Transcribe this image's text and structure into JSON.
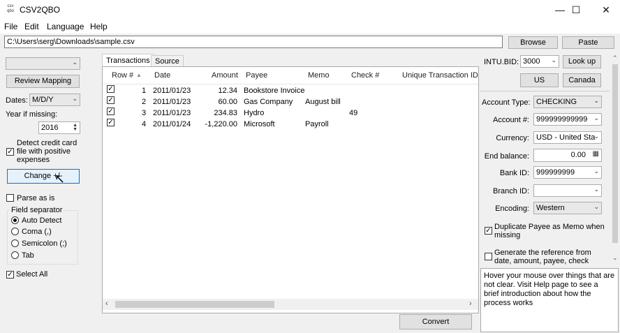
{
  "window": {
    "title": "CSV2QBO",
    "app_icon": "csv\nqbo"
  },
  "menu": [
    "File",
    "Edit",
    "Language",
    "Help"
  ],
  "file_path": "C:\\Users\\serg\\Downloads\\sample.csv",
  "buttons": {
    "browse": "Browse",
    "paste": "Paste",
    "review_mapping": "Review Mapping",
    "change": "Change +/-",
    "convert": "Convert",
    "look_up": "Look up",
    "us": "US",
    "canada": "Canada"
  },
  "left": {
    "dates_label": "Dates:",
    "dates_value": "M/D/Y",
    "year_label": "Year if missing:",
    "year_value": "2016",
    "detect_cc": "Detect credit card file with positive expenses",
    "parse_as_is": "Parse as is",
    "field_separator": "Field separator",
    "radios": [
      "Auto Detect",
      "Coma (,)",
      "Semicolon (;)",
      "Tab"
    ],
    "select_all": "Select All"
  },
  "tabs": [
    "Transactions",
    "Source"
  ],
  "table": {
    "headers": [
      "Row #",
      "Date",
      "Amount",
      "Payee",
      "Memo",
      "Check #",
      "Unique Transaction ID"
    ],
    "rows": [
      {
        "row": "1",
        "date": "2011/01/23",
        "amount": "12.34",
        "payee": "Bookstore Invoice",
        "memo": "",
        "check": ""
      },
      {
        "row": "2",
        "date": "2011/01/23",
        "amount": "60.00",
        "payee": "Gas Company",
        "memo": "August bill",
        "check": ""
      },
      {
        "row": "3",
        "date": "2011/01/23",
        "amount": "234.83",
        "payee": "Hydro",
        "memo": "",
        "check": "49"
      },
      {
        "row": "4",
        "date": "2011/01/24",
        "amount": "-1,220.00",
        "payee": "Microsoft",
        "memo": "Payroll",
        "check": ""
      }
    ]
  },
  "right": {
    "intu_bid_label": "INTU.BID:",
    "intu_bid_value": "3000",
    "account_type_label": "Account Type:",
    "account_type_value": "CHECKING",
    "account_num_label": "Account #:",
    "account_num_value": "999999999999",
    "currency_label": "Currency:",
    "currency_value": "USD - United Sta",
    "end_balance_label": "End balance:",
    "end_balance_value": "0.00",
    "bank_id_label": "Bank ID:",
    "bank_id_value": "999999999",
    "branch_id_label": "Branch ID:",
    "branch_id_value": "",
    "encoding_label": "Encoding:",
    "encoding_value": "Western",
    "dup_payee": "Duplicate Payee as Memo when missing",
    "gen_ref": "Generate the reference from date, amount, payee, check",
    "hint": "Hover your mouse over things that are not clear. Visit Help page to see a brief introduction about how the process works"
  }
}
